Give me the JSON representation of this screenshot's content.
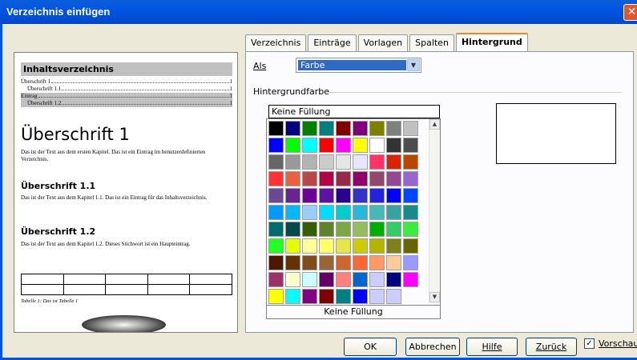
{
  "window": {
    "title": "Verzeichnis einfügen",
    "close_symbol": "✕"
  },
  "tabs": [
    {
      "label": "Verzeichnis",
      "active": false
    },
    {
      "label": "Einträge",
      "active": false
    },
    {
      "label": "Vorlagen",
      "active": false
    },
    {
      "label": "Spalten",
      "active": false
    },
    {
      "label": "Hintergrund",
      "active": true
    }
  ],
  "background": {
    "as_label": "Als",
    "as_value": "Farbe",
    "section_label": "Hintergrundfarbe",
    "selected_color_name": "Keine Füllung",
    "palette_footer": "Keine Füllung",
    "palette": [
      "#000000",
      "#000080",
      "#008000",
      "#008080",
      "#800000",
      "#800080",
      "#808000",
      "#808080",
      "#c0c0c0",
      "#0000ff",
      "#00ff00",
      "#00ffff",
      "#ff0000",
      "#ff00ff",
      "#ffff00",
      "#ffffff",
      "#333333",
      "#4d4d4d",
      "#666666",
      "#999999",
      "#b3b3b3",
      "#cccccc",
      "#e6e6e6",
      "#e6e6ff",
      "#ff3366",
      "#dc2300",
      "#b84700",
      "#ff3333",
      "#eb613d",
      "#b84747",
      "#b80047",
      "#99284c",
      "#94006b",
      "#94476b",
      "#944794",
      "#9966cc",
      "#6b4794",
      "#6b2394",
      "#6b0094",
      "#5e11a6",
      "#28008c",
      "#3333cc",
      "#2323dc",
      "#0000ff",
      "#0047ff",
      "#0099ff",
      "#00b8ff",
      "#99ccff",
      "#00dcff",
      "#00cccc",
      "#23b8dc",
      "#47b8b8",
      "#33a3a3",
      "#198a8a",
      "#006b6b",
      "#004a4a",
      "#355e00",
      "#5c8526",
      "#7da647",
      "#94bd5e",
      "#00ae00",
      "#33cc66",
      "#3deb3d",
      "#23ff23",
      "#e6ff00",
      "#ffff99",
      "#ffff66",
      "#e6e64c",
      "#cccc00",
      "#b3b300",
      "#808019",
      "#666600",
      "#4c1900",
      "#663300",
      "#804c19",
      "#996633",
      "#cc6633",
      "#ff6633",
      "#ff9966",
      "#ffcc99",
      "#9999ff",
      "#993366",
      "#ffffcc",
      "#ccffff",
      "#660066",
      "#ff8080",
      "#0066cc",
      "#ccccff",
      "#000080",
      "#ff00ff",
      "#ffff00",
      "#00ffff",
      "#800080",
      "#800000",
      "#008080",
      "#0000ff",
      "#ccccff",
      "#ccccff"
    ]
  },
  "preview": {
    "toc_title": "Inhaltsverzeichnis",
    "toc_entries": [
      {
        "label": "Überschrift 1",
        "page": "1",
        "indent": 0,
        "shaded": false
      },
      {
        "label": "Überschrift 1.1",
        "page": "1",
        "indent": 8,
        "shaded": false
      },
      {
        "label": "Eintrag",
        "page": "1",
        "indent": 0,
        "shaded": true
      },
      {
        "label": "Überschrift 1.2",
        "page": "1",
        "indent": 8,
        "shaded": true
      }
    ],
    "h1": "Überschrift 1",
    "h1_text": "Das ist der Text aus dem ersten Kapitel. Das ist ein Eintrag im benutzerdefinierten Verzeichnis.",
    "h11": "Überschrift 1.1",
    "h11_text": "Das ist der Text aus dem Kapitel 1.1. Das ist ein Eintrag für das Inhaltsverzeichnis.",
    "h12": "Überschrift 1.2",
    "h12_text": "Das ist der Text aus dem Kapitel 1.2. Dieses Stichwort ist ein Haupteintrag.",
    "caption": "Tabelle 1: Das ist Tabelle 1"
  },
  "buttons": {
    "ok": "OK",
    "cancel": "Abbrechen",
    "help": "Hilfe",
    "back": "Zurück",
    "preview_check": "Vorschau",
    "preview_checked": true,
    "check_mark": "✓"
  }
}
